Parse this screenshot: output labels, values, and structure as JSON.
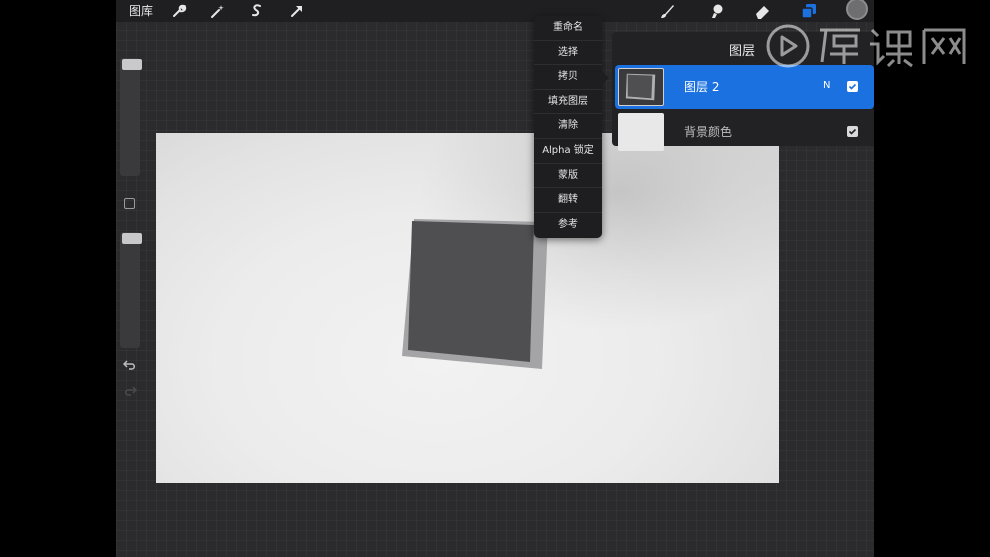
{
  "topbar": {
    "gallery_label": "图库",
    "icons": [
      "wrench-icon",
      "magic-wand-icon",
      "selection-icon",
      "transform-arrow-icon",
      "brush-icon",
      "smudge-icon",
      "eraser-icon",
      "layers-icon",
      "color-swatch"
    ]
  },
  "sidebar": {
    "brush_size_level": 0.0,
    "opacity_level": 0.0,
    "icons": [
      "modify-square",
      "undo-icon",
      "redo-icon"
    ]
  },
  "context_menu": {
    "items": [
      "重命名",
      "选择",
      "拷贝",
      "填充图层",
      "清除",
      "Alpha 锁定",
      "蒙版",
      "翻转",
      "参考"
    ]
  },
  "layers_panel": {
    "title": "图层",
    "layers": [
      {
        "name": "图层 2",
        "blend_mode": "N",
        "visible": true,
        "active": true
      },
      {
        "name": "背景颜色",
        "visible": true,
        "active": false
      }
    ]
  },
  "colors": {
    "accent": "#1b71e0",
    "toolbar_bg": "#1f1f21",
    "menu_bg": "#1e1e20",
    "square_fill": "#4f4f51",
    "square_border": "#a4a4a6"
  }
}
